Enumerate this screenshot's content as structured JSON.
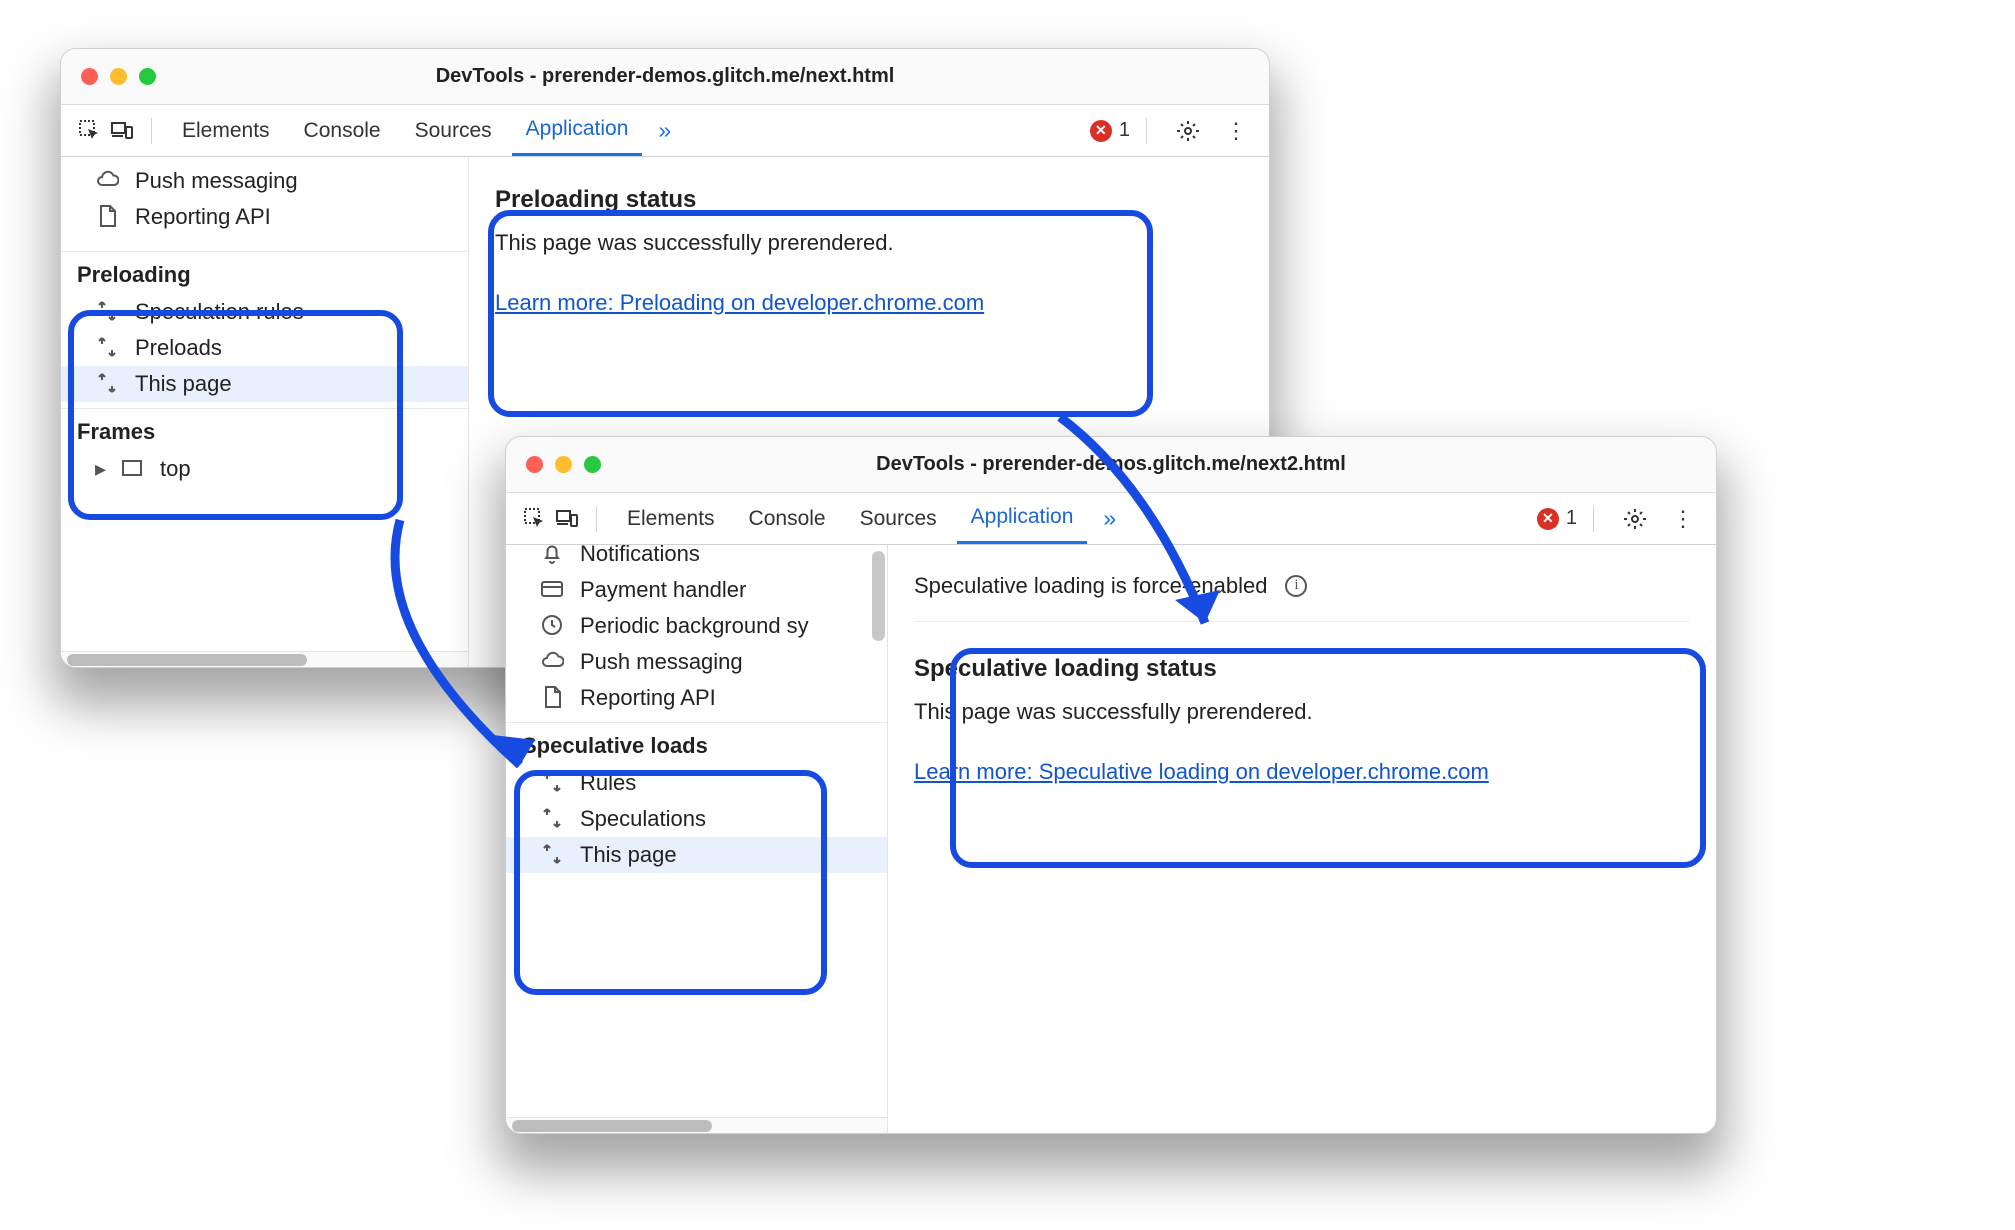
{
  "window1": {
    "title": "DevTools - prerender-demos.glitch.me/next.html",
    "tabs": {
      "elements": "Elements",
      "console": "Console",
      "sources": "Sources",
      "application": "Application"
    },
    "errors": "1",
    "sidebar": {
      "misc": {
        "push": "Push messaging",
        "reporting": "Reporting API"
      },
      "preloading": {
        "header": "Preloading",
        "rules": "Speculation rules",
        "preloads": "Preloads",
        "thispage": "This page"
      },
      "frames": {
        "header": "Frames",
        "top": "top"
      }
    },
    "content": {
      "heading": "Preloading status",
      "body": "This page was successfully prerendered.",
      "link": "Learn more: Preloading on developer.chrome.com"
    }
  },
  "window2": {
    "title": "DevTools - prerender-demos.glitch.me/next2.html",
    "tabs": {
      "elements": "Elements",
      "console": "Console",
      "sources": "Sources",
      "application": "Application"
    },
    "errors": "1",
    "sidebar": {
      "misc": {
        "notifs": "Notifications",
        "payment": "Payment handler",
        "periodic": "Periodic background sy",
        "push": "Push messaging",
        "reporting": "Reporting API"
      },
      "specload": {
        "header": "Speculative loads",
        "rules": "Rules",
        "speculations": "Speculations",
        "thispage": "This page"
      }
    },
    "content": {
      "banner": "Speculative loading is force-enabled",
      "heading": "Speculative loading status",
      "body": "This page was successfully prerendered.",
      "link": "Learn more: Speculative loading on developer.chrome.com"
    }
  }
}
